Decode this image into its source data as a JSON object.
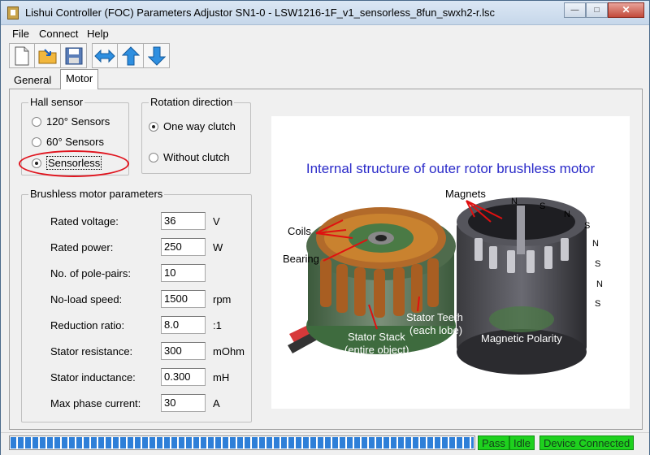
{
  "window": {
    "title": "Lishui Controller (FOC) Parameters Adjustor SN1-0 - LSW1216-1F_v1_sensorless_8fun_swxh2-r.lsc",
    "minimize_glyph": "—",
    "maximize_glyph": "□",
    "close_glyph": "✕"
  },
  "menu": {
    "file": "File",
    "connect": "Connect",
    "help": "Help"
  },
  "toolbar": {
    "icons": [
      "new-file-icon",
      "open-folder-icon",
      "save-icon",
      "left-right-arrow-icon",
      "up-arrow-icon",
      "down-arrow-icon"
    ]
  },
  "tabs": {
    "general": "General",
    "motor": "Motor"
  },
  "hall_sensor": {
    "title": "Hall sensor",
    "options": [
      "120° Sensors",
      "60° Sensors",
      "Sensorless"
    ],
    "selected": "Sensorless"
  },
  "rotation": {
    "title": "Rotation direction",
    "options": [
      "One way clutch",
      "Without clutch"
    ],
    "selected": "One way clutch"
  },
  "params": {
    "title": "Brushless motor parameters",
    "rows": [
      {
        "label": "Rated voltage:",
        "value": "36",
        "unit": "V"
      },
      {
        "label": "Rated power:",
        "value": "250",
        "unit": "W"
      },
      {
        "label": "No. of pole-pairs:",
        "value": "10",
        "unit": ""
      },
      {
        "label": "No-load speed:",
        "value": "1500",
        "unit": "rpm"
      },
      {
        "label": "Reduction ratio:",
        "value": "8.0",
        "unit": ":1"
      },
      {
        "label": "Stator resistance:",
        "value": "300",
        "unit": "mOhm"
      },
      {
        "label": "Stator inductance:",
        "value": "0.300",
        "unit": "mH"
      },
      {
        "label": "Max phase current:",
        "value": "30",
        "unit": "A"
      }
    ]
  },
  "diagram": {
    "title": "Internal structure of outer rotor brushless motor",
    "labels": {
      "magnets": "Magnets",
      "coils": "Coils",
      "bearing": "Bearing",
      "stator_teeth": "Stator Teeth",
      "stator_teeth_sub": "(each lobe)",
      "stator_stack": "Stator Stack",
      "stator_stack_sub": "(entire object)",
      "magnetic_polarity": "Magnetic Polarity"
    },
    "pole_n": "N",
    "pole_s": "S"
  },
  "status": {
    "progress": 1.0,
    "pass": "Pass",
    "idle": "Idle",
    "device": "Device Connected",
    "color": "#1ed11e"
  }
}
